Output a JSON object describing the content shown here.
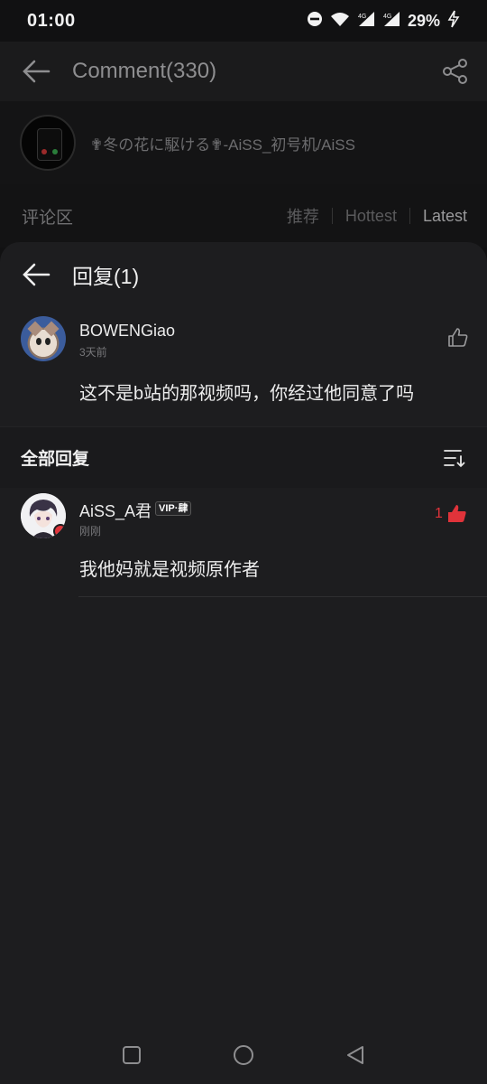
{
  "status_bar": {
    "time": "01:00",
    "battery": "29%",
    "network_1": "4G",
    "network_2": "4G"
  },
  "header": {
    "title": "Comment(330)",
    "back_icon": "arrow-left-icon",
    "share_icon": "share-icon"
  },
  "song": {
    "title": "✟冬の花に駆ける✟-AiSS_初号机/AiSS"
  },
  "tabs": {
    "section_label": "评论区",
    "items": [
      "推荐",
      "Hottest",
      "Latest"
    ],
    "active": "Latest"
  },
  "reply_sheet": {
    "title": "回复(1)",
    "original_comment": {
      "user": "BOWENGiao",
      "time": "3天前",
      "text": "这不是b站的那视频吗，你经过他同意了吗"
    },
    "all_replies_label": "全部回复",
    "replies": [
      {
        "user": "AiSS_A君",
        "badge": "VIP·肆",
        "time": "刚刚",
        "text": "我他妈就是视频原作者",
        "likes": "1"
      }
    ]
  },
  "colors": {
    "accent_red": "#e0333a",
    "sheet_bg": "#1d1d1f",
    "page_bg": "#111112"
  }
}
